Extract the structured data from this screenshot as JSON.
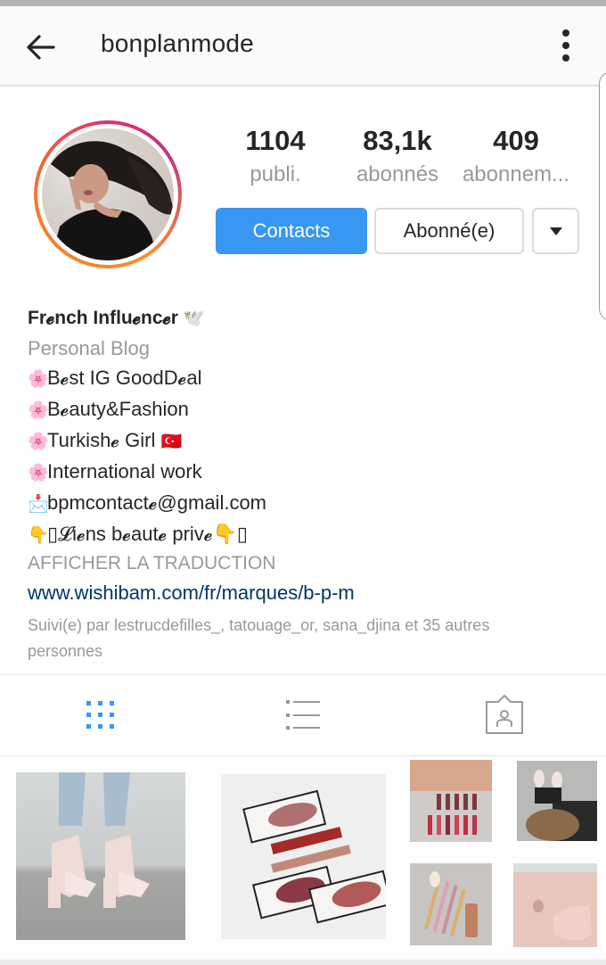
{
  "header": {
    "username": "bonplanmode",
    "back_icon": "arrow-left-icon",
    "more_icon": "more-vertical-icon"
  },
  "profile": {
    "avatar_alt": "profile picture with story ring",
    "stats": [
      {
        "value": "1104",
        "label": "publi."
      },
      {
        "value": "83,1k",
        "label": "abonnés"
      },
      {
        "value": "409",
        "label": "abonnem..."
      }
    ],
    "buttons": {
      "contacts": "Contacts",
      "following": "Abonné(e)",
      "dropdown_icon": "caret-down-icon"
    }
  },
  "bio": {
    "name": "Fr𝓮nch Influ𝓮nc𝓮r",
    "name_emoji": "🕊️",
    "category": "Personal Blog",
    "lines": [
      {
        "emoji": "🌸",
        "text": "B𝓮st IG GoodD𝓮al"
      },
      {
        "emoji": "🌸",
        "text": "B𝓮auty&Fashion"
      },
      {
        "emoji": "🌸",
        "text": "Turkish𝓮 Girl",
        "suffix_emoji": "🇹🇷"
      },
      {
        "emoji": "🌸",
        "text": "International work"
      },
      {
        "emoji": "📩",
        "text": "bpmcontact𝓮@gmail.com"
      },
      {
        "emoji": "👇",
        "text": "▯𝓛i𝓮ns b𝓮aut𝓮 priv𝓮",
        "suffix_emoji": "👇▯"
      }
    ],
    "translate": "AFFICHER LA TRADUCTION",
    "link": "www.wishibam.com/fr/marques/b-p-m",
    "followed_by": "Suivi(e) par lestrucdefilles_, tatouage_or, sana_djina et 35 autres personnes"
  },
  "tabs": [
    {
      "name": "grid",
      "icon": "grid-icon",
      "active": true
    },
    {
      "name": "list",
      "icon": "list-icon",
      "active": false
    },
    {
      "name": "tagged",
      "icon": "tagged-photos-icon",
      "active": false
    }
  ],
  "posts": [
    {
      "alt": "pink velvet lace-up heels"
    },
    {
      "alt": "liquid lipstick boxes on white fur"
    },
    {
      "alt": "lipsticks with quilted bag"
    },
    {
      "alt": "sneakers and fur bag"
    },
    {
      "alt": "makeup brushes and foundation"
    },
    {
      "alt": "rose gold laptop with manicured hand"
    }
  ],
  "colors": {
    "accent": "#3897f0",
    "link": "#003569",
    "muted": "#999999",
    "text": "#262626"
  }
}
